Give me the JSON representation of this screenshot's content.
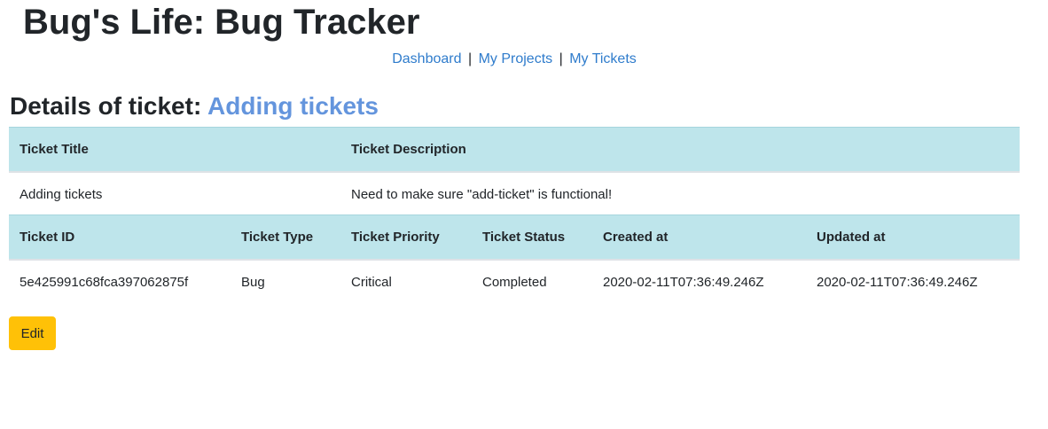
{
  "header": {
    "title": "Bug's Life: Bug Tracker"
  },
  "nav": {
    "items": [
      {
        "label": "Dashboard"
      },
      {
        "label": "My Projects"
      },
      {
        "label": "My Tickets"
      }
    ],
    "separator": "|"
  },
  "details": {
    "heading_prefix": "Details of ticket:",
    "ticket_title_link": "Adding tickets"
  },
  "summary_table": {
    "headers": [
      "Ticket Title",
      "Ticket Description"
    ],
    "row": [
      "Adding tickets",
      "Need to make sure \"add-ticket\" is functional!"
    ]
  },
  "info_table": {
    "headers": [
      "Ticket ID",
      "Ticket Type",
      "Ticket Priority",
      "Ticket Status",
      "Created at",
      "Updated at"
    ],
    "row": [
      "5e425991c68fca397062875f",
      "Bug",
      "Critical",
      "Completed",
      "2020-02-11T07:36:49.246Z",
      "2020-02-11T07:36:49.246Z"
    ]
  },
  "actions": {
    "edit_label": "Edit"
  },
  "colors": {
    "link": "#2f7ccc",
    "heading_link": "#6495dd",
    "table_header_bg": "#bee5eb",
    "edit_button_bg": "#ffc107",
    "text": "#212529"
  }
}
